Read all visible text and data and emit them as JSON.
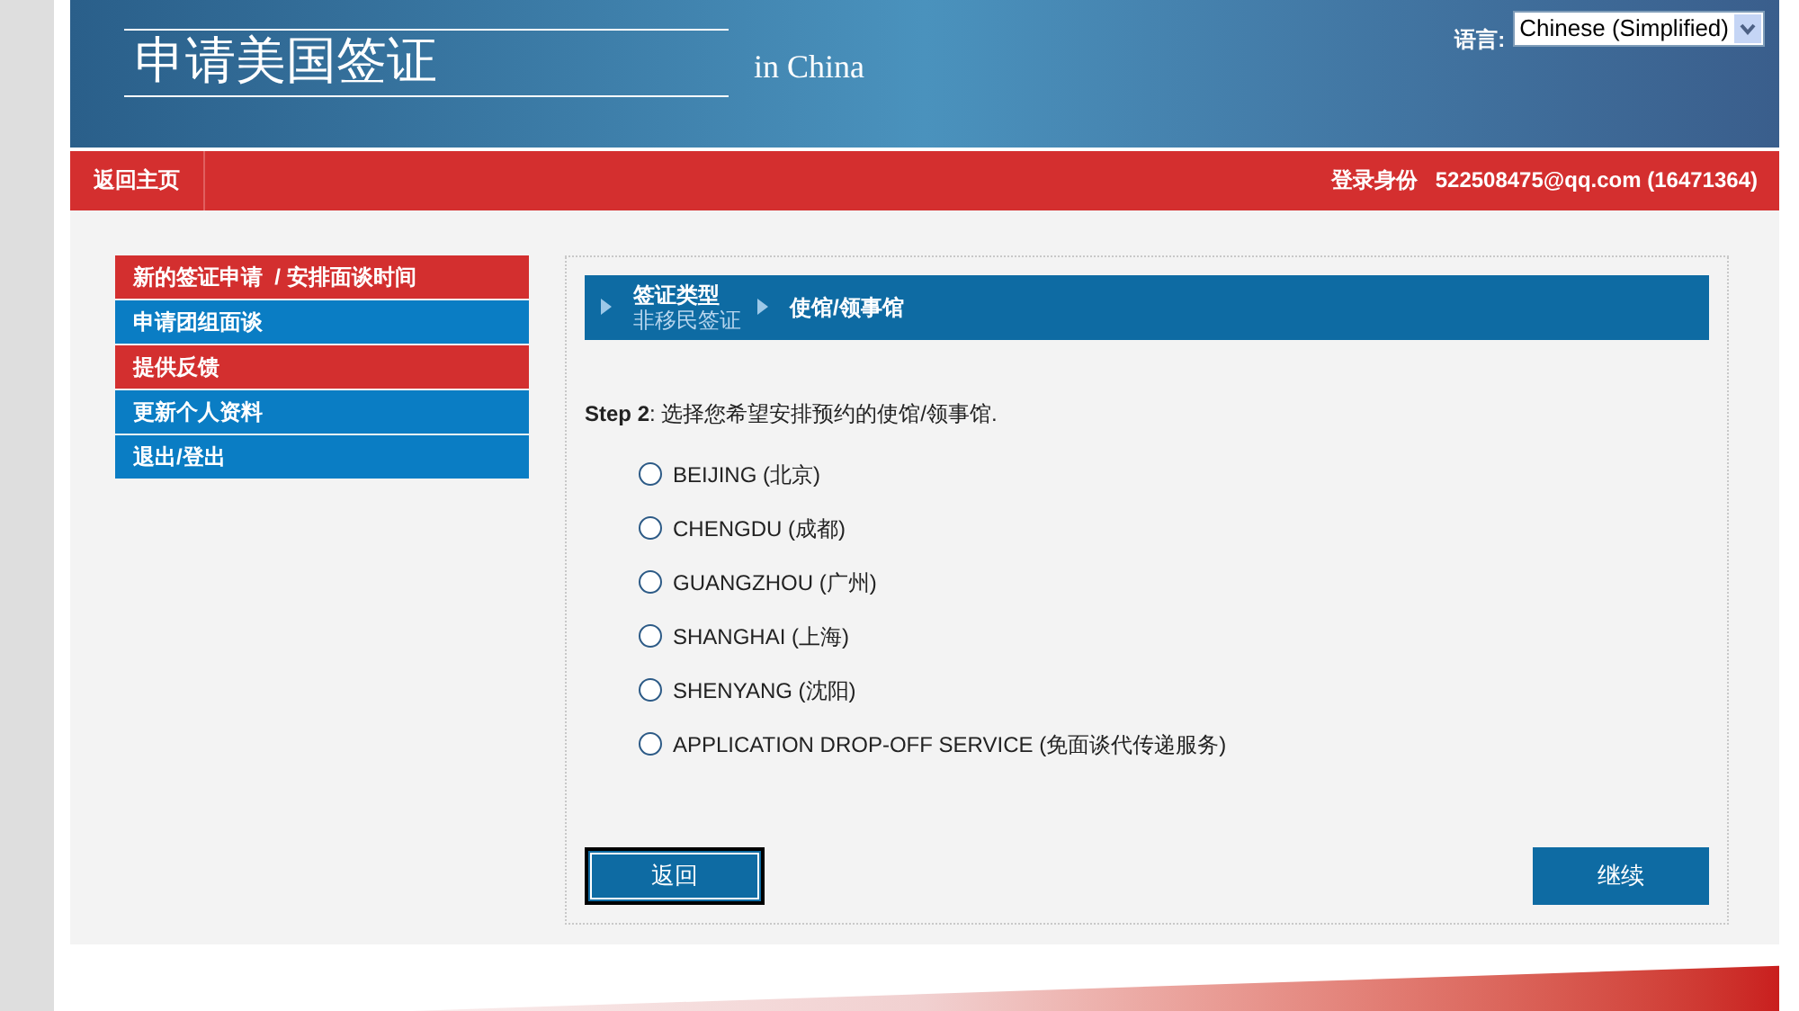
{
  "header": {
    "title": "申请美国签证",
    "subtitle": "in China",
    "language_label": "语言:",
    "language_value": "Chinese (Simplified)"
  },
  "nav_bar": {
    "home_link": "返回主页",
    "login_label": "登录身份",
    "login_value": "522508475@qq.com (16471364)"
  },
  "sidebar": {
    "items": [
      {
        "label": "新的签证申请  / 安排面谈时间",
        "color": "#d32f2f"
      },
      {
        "label": "申请团组面谈",
        "color": "#0a7dc4"
      },
      {
        "label": "提供反馈",
        "color": "#d32f2f"
      },
      {
        "label": "更新个人资料",
        "color": "#0a7dc4"
      },
      {
        "label": "退出/登出",
        "color": "#0a7dc4"
      }
    ]
  },
  "breadcrumb": [
    {
      "title": "签证类型",
      "value": "非移民签证"
    },
    {
      "title": "使馆/领事馆"
    }
  ],
  "instruction": "**Step 2**: 选择您希望安排预约的使馆/领事馆.",
  "options": [
    {
      "label": "BEIJING (北京)",
      "selected": false
    },
    {
      "label": "CHENGDU (成都)",
      "selected": false
    },
    {
      "label": "GUANGZHOU (广州)",
      "selected": false
    },
    {
      "label": "SHANGHAI (上海)",
      "selected": false
    },
    {
      "label": "SHENYANG (沈阳)",
      "selected": false
    },
    {
      "label": "APPLICATION DROP-OFF SERVICE (免面谈代传递服务)",
      "selected": false
    }
  ],
  "buttons": {
    "back": "返回",
    "continue": "继续"
  }
}
